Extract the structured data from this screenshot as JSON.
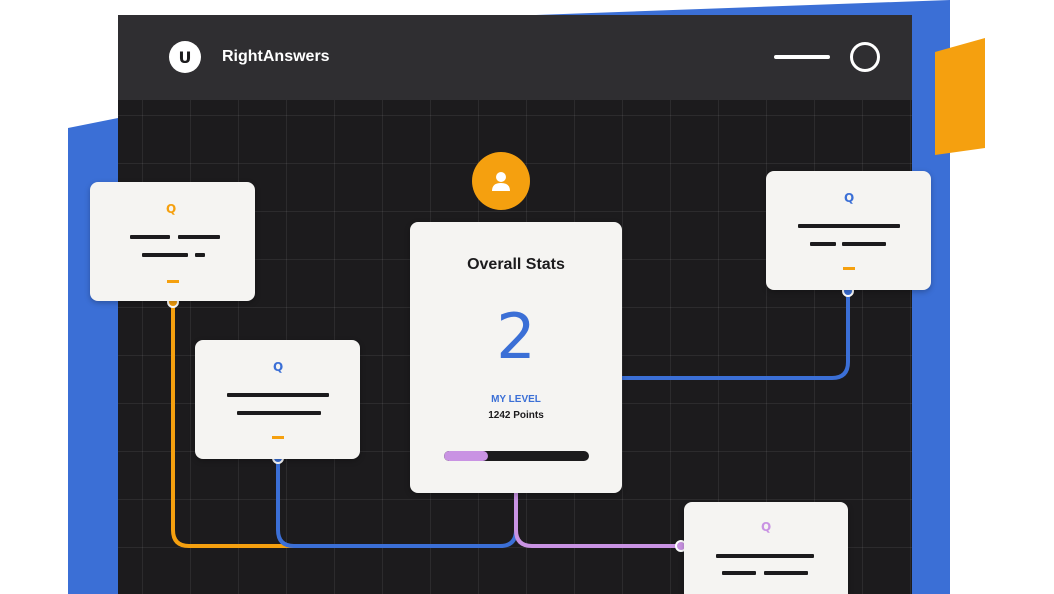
{
  "app": {
    "logo_letter": "U",
    "title": "RightAnswers"
  },
  "stats_card": {
    "title": "Overall Stats",
    "level": "2",
    "level_label": "MY LEVEL",
    "points": "1242 Points",
    "progress": 0.3
  },
  "question_cards": [
    {
      "icon": "Q",
      "icon_color": "orange",
      "dash_color": "orange"
    },
    {
      "icon": "Q",
      "icon_color": "blue",
      "dash_color": "orange"
    },
    {
      "icon": "Q",
      "icon_color": "blue",
      "dash_color": "orange"
    },
    {
      "icon": "Q",
      "icon_color": "purple"
    }
  ],
  "colors": {
    "blue": "#3b6fd6",
    "orange": "#f5a00f",
    "purple": "#c993e3",
    "dark": "#1c1b1d",
    "titlebar": "#2f2e31",
    "card": "#f5f4f2"
  }
}
